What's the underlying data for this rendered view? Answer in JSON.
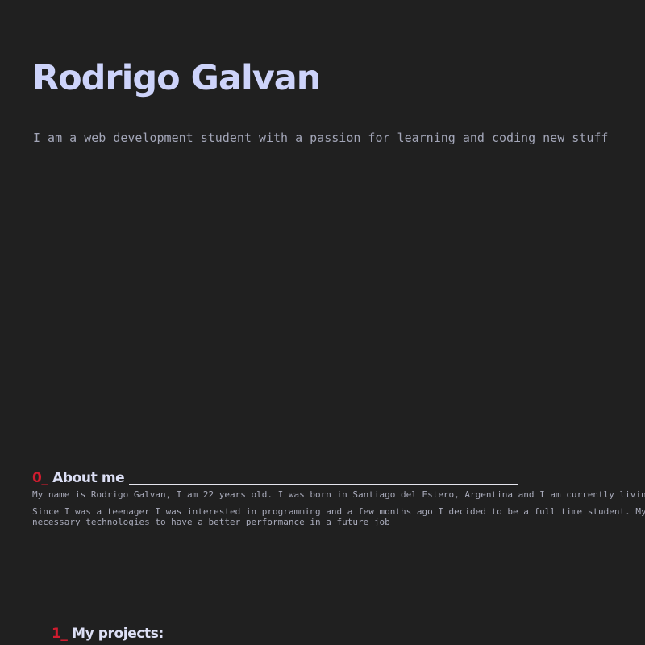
{
  "hero": {
    "name": "Rodrigo Galvan",
    "tagline": "I am a web development student with a passion for learning and coding new stuff"
  },
  "about": {
    "number": "0_",
    "title": "About me",
    "paragraph_1": "My name is Rodrigo Galvan, I am 22 years old. I was born in Santiago del Estero, Argentina and I am currently livin",
    "paragraph_2_line_1": "Since I was a teenager I was interested in programming and a few months ago I decided to be a full time student. My",
    "paragraph_2_line_2": "necessary technologies to have a better performance in a future job"
  },
  "projects": {
    "number": "1_",
    "title": "My projects:"
  },
  "colors": {
    "background": "#202020",
    "heading": "#cdd3fa",
    "accent": "#d01c2f",
    "body_text": "#a9abbb"
  }
}
